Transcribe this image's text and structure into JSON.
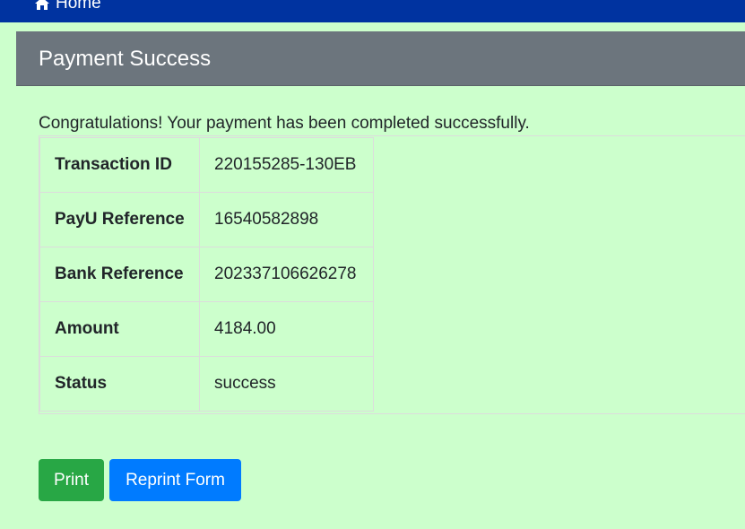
{
  "nav": {
    "home_label": "Home"
  },
  "card": {
    "title": "Payment Success",
    "message": "Congratulations! Your payment has been completed successfully."
  },
  "details": [
    {
      "label": "Transaction ID",
      "value": "220155285-130EB"
    },
    {
      "label": "PayU Reference",
      "value": "16540582898"
    },
    {
      "label": "Bank Reference",
      "value": "202337106626278"
    },
    {
      "label": "Amount",
      "value": "4184.00"
    },
    {
      "label": "Status",
      "value": "success"
    }
  ],
  "actions": {
    "print_label": "Print",
    "reprint_label": "Reprint Form"
  },
  "colors": {
    "navbar": "#0033a0",
    "page_background": "#ccffcc",
    "header": "#6c757d",
    "print_button": "#28a745",
    "reprint_button": "#007bff"
  }
}
